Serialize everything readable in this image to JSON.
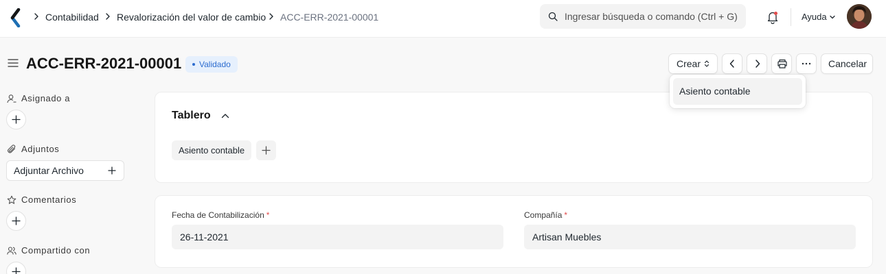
{
  "navbar": {
    "breadcrumbs": [
      "Contabilidad",
      "Revalorización del valor de cambio",
      "ACC-ERR-2021-00001"
    ],
    "search_placeholder": "Ingresar búsqueda o comando (Ctrl + G)",
    "help_label": "Ayuda"
  },
  "page": {
    "title": "ACC-ERR-2021-00001",
    "status": "Validado"
  },
  "actions": {
    "create_label": "Crear",
    "cancel_label": "Cancelar",
    "create_menu": [
      "Asiento contable"
    ]
  },
  "sidebar": {
    "assigned_label": "Asignado a",
    "attachments_label": "Adjuntos",
    "attach_button": "Adjuntar Archivo",
    "comments_label": "Comentarios",
    "shared_label": "Compartido con"
  },
  "dashboard": {
    "title": "Tablero",
    "links": [
      "Asiento contable"
    ]
  },
  "form": {
    "posting_date_label": "Fecha de Contabilización",
    "posting_date_value": "26-11-2021",
    "company_label": "Compañía",
    "company_value": "Artisan Muebles",
    "required_marker": "*"
  },
  "colors": {
    "accent": "#2c6ccf",
    "badge_bg": "#e6f0fd",
    "required": "#e24c4c"
  },
  "icons": {
    "logo": "chevron-logo-icon",
    "search": "search-icon",
    "notifications": "bell-icon",
    "menu": "hamburger-icon"
  }
}
